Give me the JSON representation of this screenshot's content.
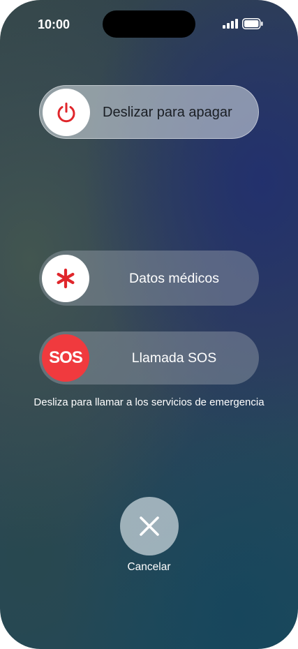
{
  "status_bar": {
    "time": "10:00"
  },
  "power_slider": {
    "label": "Deslizar para apagar",
    "icon": "power-icon"
  },
  "medical_slider": {
    "label": "Datos médicos",
    "icon": "medical-asterisk-icon"
  },
  "sos_slider": {
    "label": "Llamada SOS",
    "badge": "SOS"
  },
  "sos_hint": "Desliza para llamar a los servicios de emergencia",
  "cancel": {
    "label": "Cancelar",
    "icon": "close-icon"
  },
  "colors": {
    "sos_red": "#f03a3e",
    "power_red": "#e0262b",
    "medical_red": "#e0262b"
  }
}
